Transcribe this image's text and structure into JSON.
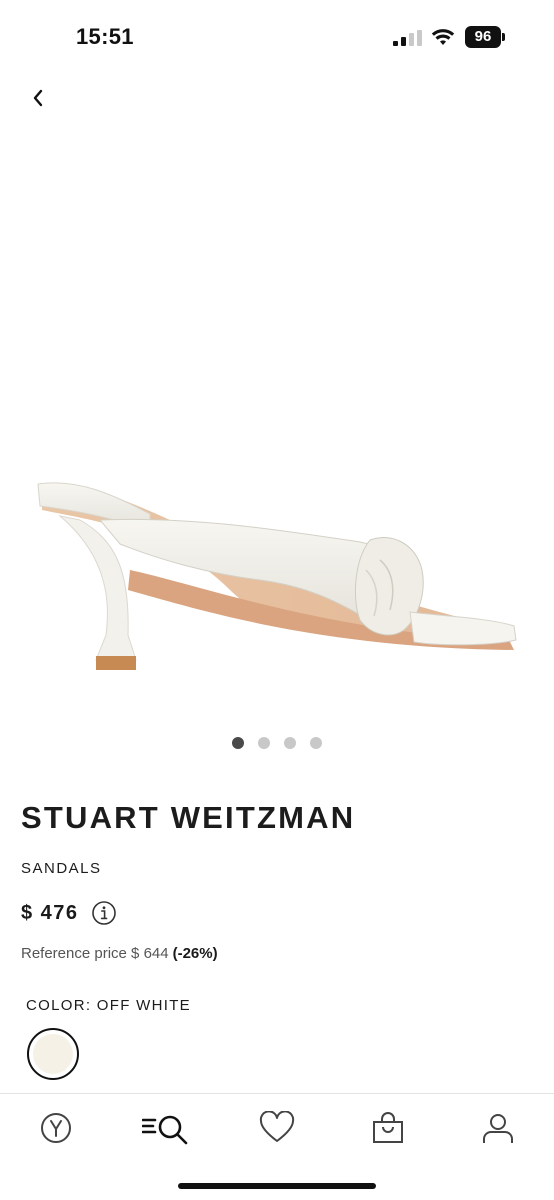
{
  "status_bar": {
    "time": "15:51",
    "battery": "96"
  },
  "product": {
    "brand": "STUART WEITZMAN",
    "category": "SANDALS",
    "price": "$ 476",
    "reference_label": "Reference price $ 644",
    "discount": "(-26%)",
    "color_label": "COLOR: OFF WHITE",
    "swatch_color": "#f6f1e6"
  },
  "carousel": {
    "total": 4,
    "active_index": 0
  },
  "nav": {
    "items": [
      "home-icon",
      "menu-search-icon",
      "heart-icon",
      "bag-icon",
      "user-icon"
    ]
  },
  "colors": {
    "text": "#1a1a1a",
    "muted": "#555555",
    "dot_active": "#4a4a4a",
    "dot_inactive": "#c8c8c8"
  }
}
